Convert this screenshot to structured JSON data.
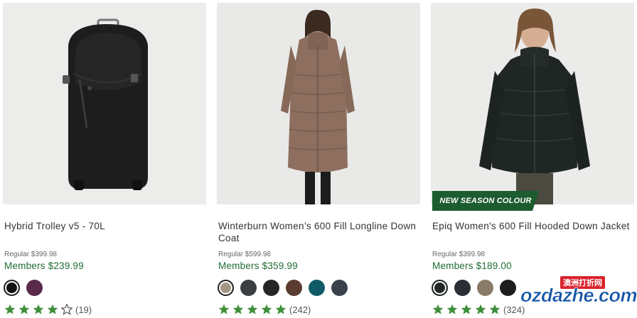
{
  "products": [
    {
      "name": "Hybrid Trolley v5 - 70L",
      "regular_label": "Regular $399.98",
      "members_label": "Members $239.99",
      "badge": "",
      "swatches": [
        {
          "color": "#111111",
          "selected": true
        },
        {
          "color": "#5a2a4b",
          "selected": false
        }
      ],
      "rating": 4,
      "review_count": "(19)"
    },
    {
      "name": "Winterburn Women’s 600 Fill Longline Down Coat",
      "regular_label": "Regular $599.98",
      "members_label": "Members $359.99",
      "badge": "",
      "swatches": [
        {
          "color": "#a59685",
          "selected": true
        },
        {
          "color": "#3a3f41",
          "selected": false
        },
        {
          "color": "#262626",
          "selected": false
        },
        {
          "color": "#5b3c30",
          "selected": false
        },
        {
          "color": "#0f5a67",
          "selected": false
        },
        {
          "color": "#3b414c",
          "selected": false
        }
      ],
      "rating": 5,
      "review_count": "(242)"
    },
    {
      "name": "Epiq Women's 600 Fill Hooded Down Jacket",
      "regular_label": "Regular $399.98",
      "members_label": "Members $189.00",
      "badge": "NEW SEASON COLOUR",
      "swatches": [
        {
          "color": "#222828",
          "selected": true
        },
        {
          "color": "#2a2e35",
          "selected": false
        },
        {
          "color": "#8a7a68",
          "selected": false
        },
        {
          "color": "#1e1e1e",
          "selected": false
        }
      ],
      "rating": 5,
      "review_count": "(324)"
    }
  ],
  "watermark": {
    "top_text": "澳洲打折网",
    "main_text": "ozdazhe.com"
  },
  "colors": {
    "members_green": "#1f6b33",
    "badge_green": "#1d5c2e",
    "star_green": "#3f8f3a"
  }
}
